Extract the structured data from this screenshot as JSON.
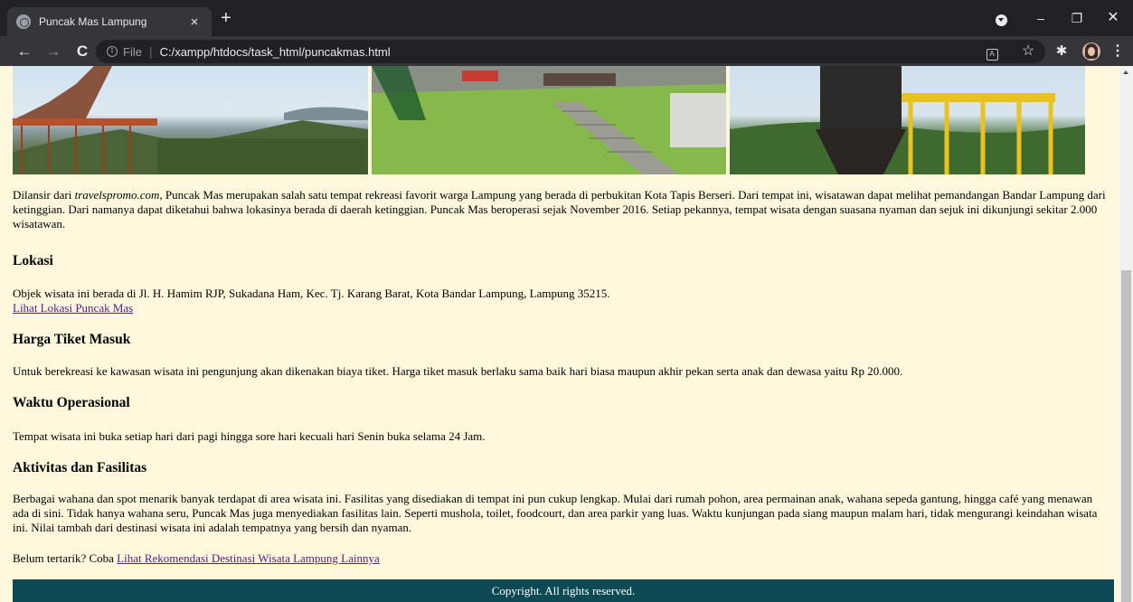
{
  "browser": {
    "tab_title": "Puncak Mas Lampung",
    "tab_close": "×",
    "new_tab": "+",
    "scheme": "File",
    "url": "C:/xampp/htdocs/task_html/puncakmas.html",
    "icons": [
      "globe-icon",
      "close-icon",
      "plus-icon",
      "back-icon",
      "forward-icon",
      "reload-icon",
      "info-icon",
      "translate-icon",
      "star-icon",
      "puzzle-icon",
      "avatar",
      "menu-icon"
    ]
  },
  "page": {
    "intro_before": "Dilansir dari ",
    "intro_source": "travelspromo.com",
    "intro_after": ", Puncak Mas merupakan salah satu tempat rekreasi favorit warga Lampung yang berada di perbukitan Kota Tapis Berseri. Dari tempat ini, wisatawan dapat melihat pemandangan Bandar Lampung dari ketinggian. Dari namanya dapat diketahui bahwa lokasinya berada di daerah ketinggian. Puncak Mas beroperasi sejak November 2016. Setiap pekannya, tempat wisata dengan suasana nyaman dan sejuk ini dikunjungi sekitar 2.000 wisatawan.",
    "lokasi": {
      "heading": "Lokasi",
      "text": "Objek wisata ini berada di Jl. H. Hamim RJP, Sukadana Ham, Kec. Tj. Karang Barat, Kota Bandar Lampung, Lampung 35215.",
      "link": "Lihat Lokasi Puncak Mas"
    },
    "tiket": {
      "heading": "Harga Tiket Masuk",
      "text": "Untuk berekreasi ke kawasan wisata ini pengunjung akan dikenakan biaya tiket. Harga tiket masuk berlaku sama baik hari biasa maupun akhir pekan serta anak dan dewasa yaitu Rp 20.000."
    },
    "waktu": {
      "heading": "Waktu Operasional",
      "text": "Tempat wisata ini buka setiap hari dari pagi hingga sore hari kecuali hari Senin buka selama 24 Jam."
    },
    "aktivitas": {
      "heading": "Aktivitas dan Fasilitas",
      "text": "Berbagai wahana dan spot menarik banyak terdapat di area wisata ini. Fasilitas yang disediakan di tempat ini pun cukup lengkap. Mulai dari rumah pohon, area permainan anak, wahana sepeda gantung, hingga café yang menawan ada di sini. Tidak hanya wahana seru, Puncak Mas juga menyediakan fasilitas lain. Seperti mushola, toilet, foodcourt, dan area parkir yang luas. Waktu kunjungan pada siang maupun malam hari, tidak mengurangi keindahan wisata ini. Nilai tambah dari destinasi wisata ini adalah tempatnya yang bersih dan nyaman."
    },
    "cta_text": "Belum tertarik? Coba ",
    "cta_link": "Lihat Rekomendasi Destinasi Wisata Lampung Lainnya",
    "footer": "Copyright. All rights reserved."
  },
  "colors": {
    "page_background": "#fff8dc",
    "footer_background": "#0b4a55",
    "link": "#551a8b",
    "chrome_dark": "#202124",
    "chrome_toolbar": "#35363a"
  }
}
